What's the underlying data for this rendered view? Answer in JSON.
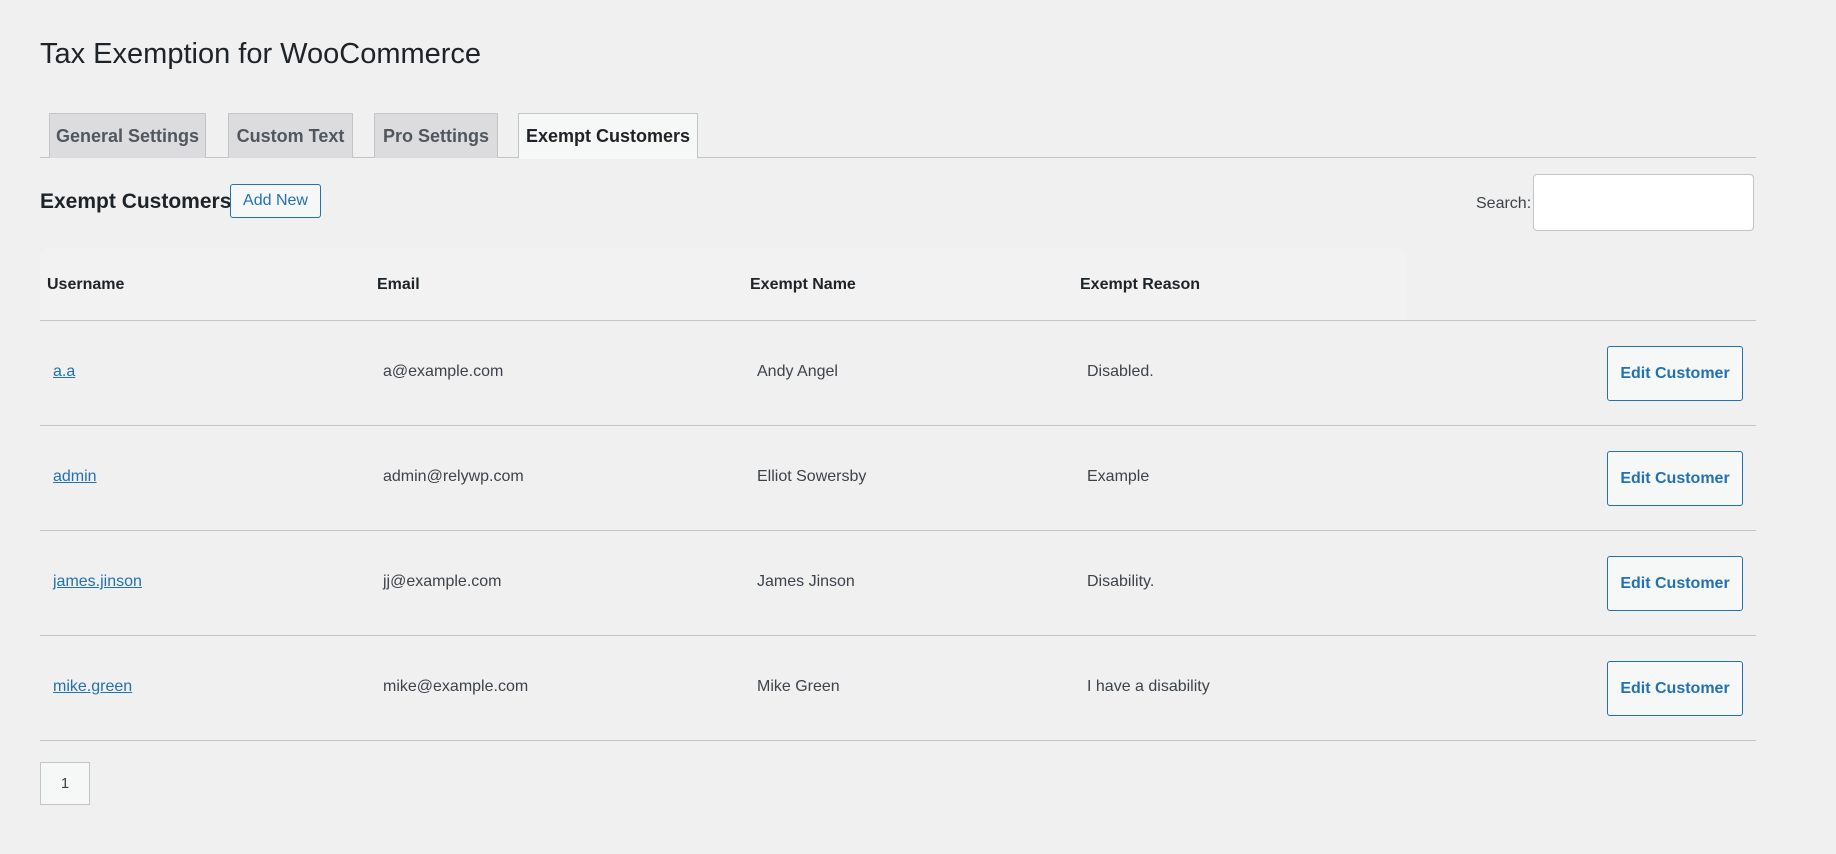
{
  "page": {
    "title": "Tax Exemption for WooCommerce"
  },
  "tabs": [
    {
      "label": "General Settings"
    },
    {
      "label": "Custom Text"
    },
    {
      "label": "Pro Settings"
    },
    {
      "label": "Exempt Customers",
      "active": true
    }
  ],
  "section": {
    "title": "Exempt Customers",
    "add_new_label": "Add New"
  },
  "search": {
    "label": "Search:",
    "value": ""
  },
  "table": {
    "columns": [
      "Username",
      "Email",
      "Exempt Name",
      "Exempt Reason"
    ],
    "rows": [
      {
        "username": "a.a",
        "email": "a@example.com",
        "exempt_name": "Andy Angel",
        "exempt_reason": "Disabled.",
        "action": "Edit Customer"
      },
      {
        "username": "admin",
        "email": "admin@relywp.com",
        "exempt_name": "Elliot Sowersby",
        "exempt_reason": "Example",
        "action": "Edit Customer"
      },
      {
        "username": "james.jinson",
        "email": "jj@example.com",
        "exempt_name": "James Jinson",
        "exempt_reason": "Disability.",
        "action": "Edit Customer"
      },
      {
        "username": "mike.green",
        "email": "mike@example.com",
        "exempt_name": "Mike Green",
        "exempt_reason": "I have a disability",
        "action": "Edit Customer"
      }
    ]
  },
  "pagination": {
    "current_page": "1"
  },
  "colors": {
    "link": "#2271b1",
    "background": "#f0f0f1",
    "border": "#c3c4c7"
  }
}
